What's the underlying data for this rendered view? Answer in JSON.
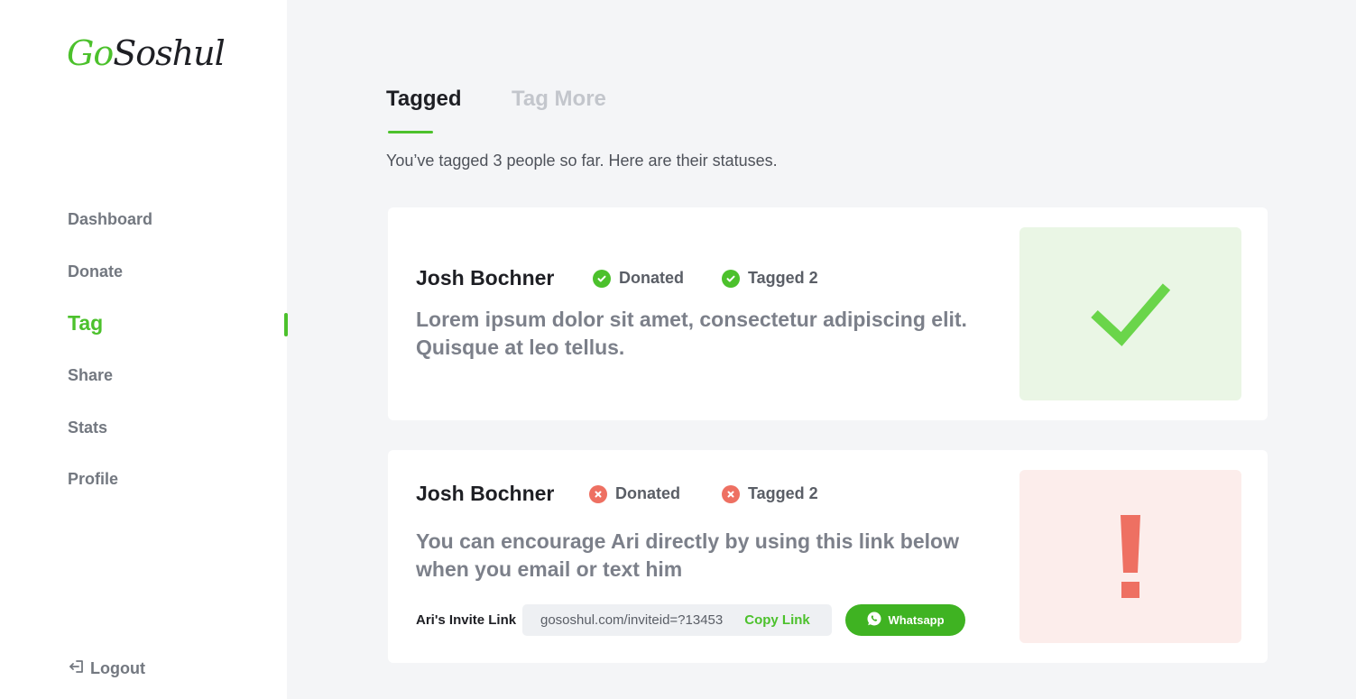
{
  "logo": {
    "part1": "Go",
    "part2": "Soshul"
  },
  "nav": {
    "items": [
      {
        "label": "Dashboard"
      },
      {
        "label": "Donate"
      },
      {
        "label": "Tag"
      },
      {
        "label": "Share"
      },
      {
        "label": "Stats"
      },
      {
        "label": "Profile"
      }
    ],
    "active": "Tag",
    "logout": "Logout"
  },
  "tabs": [
    {
      "label": "Tagged",
      "active": true
    },
    {
      "label": "Tag More",
      "active": false
    }
  ],
  "subtitle": "You’ve tagged 3 people so far. Here are their statuses.",
  "cards": [
    {
      "name": "Josh Bochner",
      "status1": {
        "label": "Donated",
        "state": "ok"
      },
      "status2": {
        "label": "Tagged 2",
        "state": "ok"
      },
      "text": "Lorem ipsum dolor sit amet, consectetur adipiscing elit. Quisque at leo tellus.",
      "panel_icon": "checkmark-icon"
    },
    {
      "name": "Josh Bochner",
      "status1": {
        "label": "Donated",
        "state": "bad"
      },
      "status2": {
        "label": "Tagged 2",
        "state": "bad"
      },
      "text": "You can encourage Ari directly by using this link below when you email or text him",
      "invite_label": "Ari's Invite Link",
      "invite_url": "gososhul.com/inviteid=?13453",
      "copy_label": "Copy Link",
      "whatsapp_label": "Whatsapp",
      "panel_icon": "exclamation-icon"
    }
  ],
  "colors": {
    "accent": "#4cc12c",
    "error": "#ee7062",
    "success_bg": "#eaf6e5",
    "error_bg": "#fcedeb",
    "whatsapp": "#3fb322"
  }
}
